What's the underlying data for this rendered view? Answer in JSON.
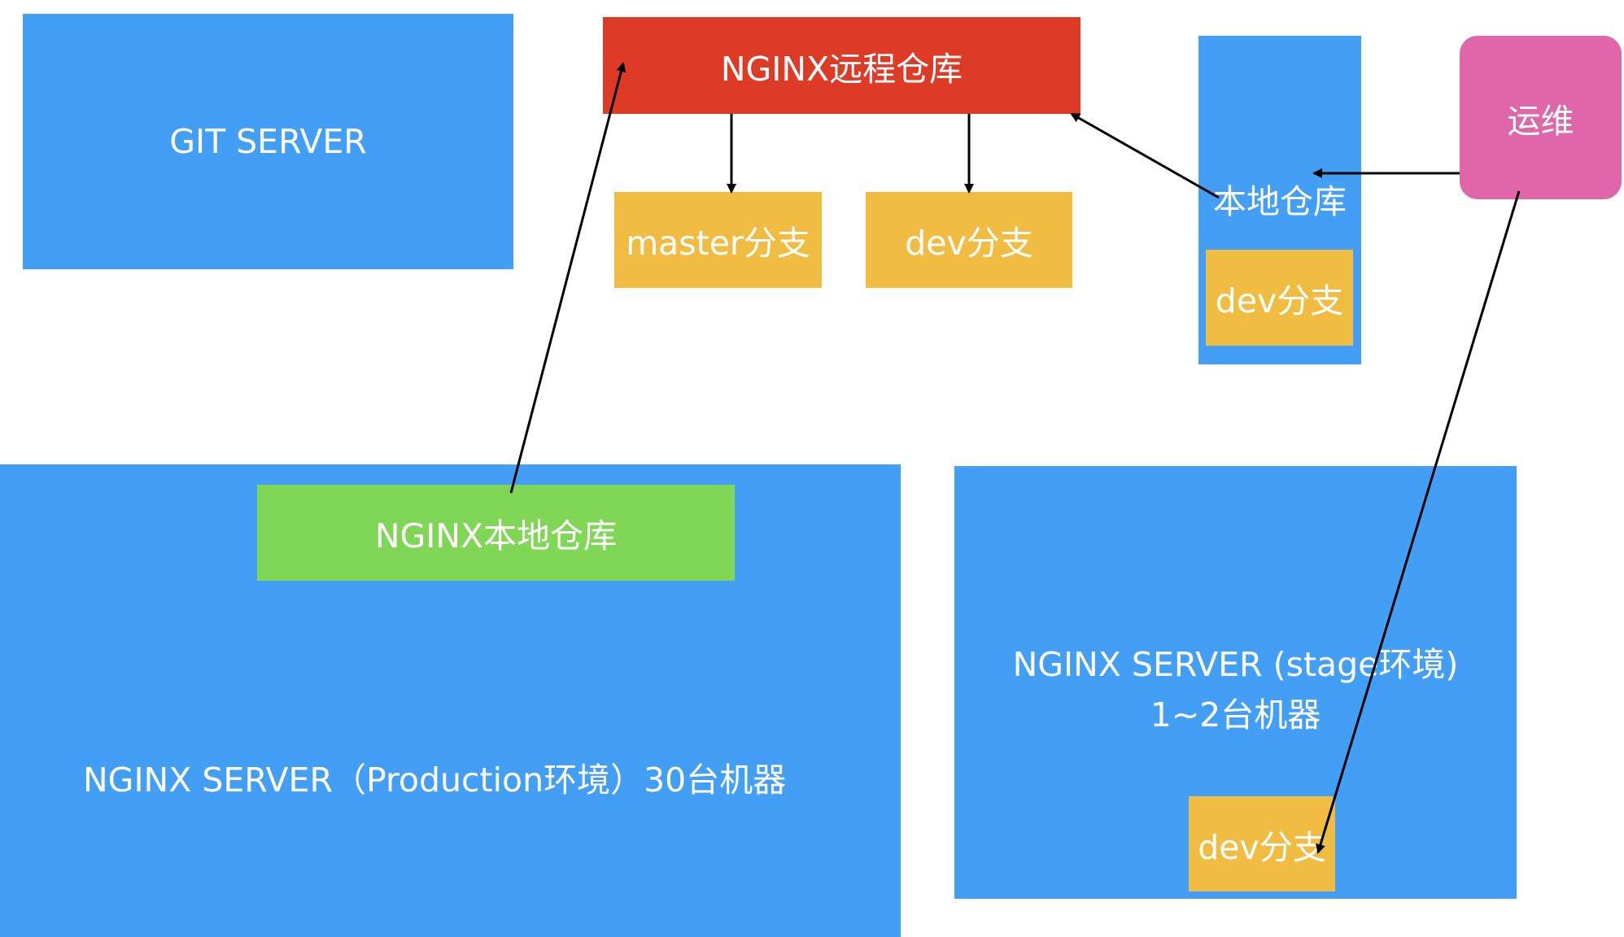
{
  "nodes": {
    "git_server": "GIT SERVER",
    "nginx_remote": "NGINX远程仓库",
    "master_branch": "master分支",
    "dev_branch_remote": "dev分支",
    "local_repo": "本地仓库",
    "dev_branch_local": "dev分支",
    "ops": "运维",
    "nginx_local": "NGINX本地仓库",
    "prod_server": "NGINX SERVER（Production环境）30台机器",
    "stage_server_line1": "NGINX SERVER (stage环境)",
    "stage_server_line2": "1~2台机器",
    "dev_branch_stage": "dev分支"
  },
  "colors": {
    "server_blue": "#439ff5",
    "remote_red": "#de3b27",
    "branch_yellow": "#f0bd42",
    "local_green": "#80d655",
    "ops_pink": "#df66a8",
    "text_white": "#ffffff",
    "arrow_black": "#000000"
  }
}
